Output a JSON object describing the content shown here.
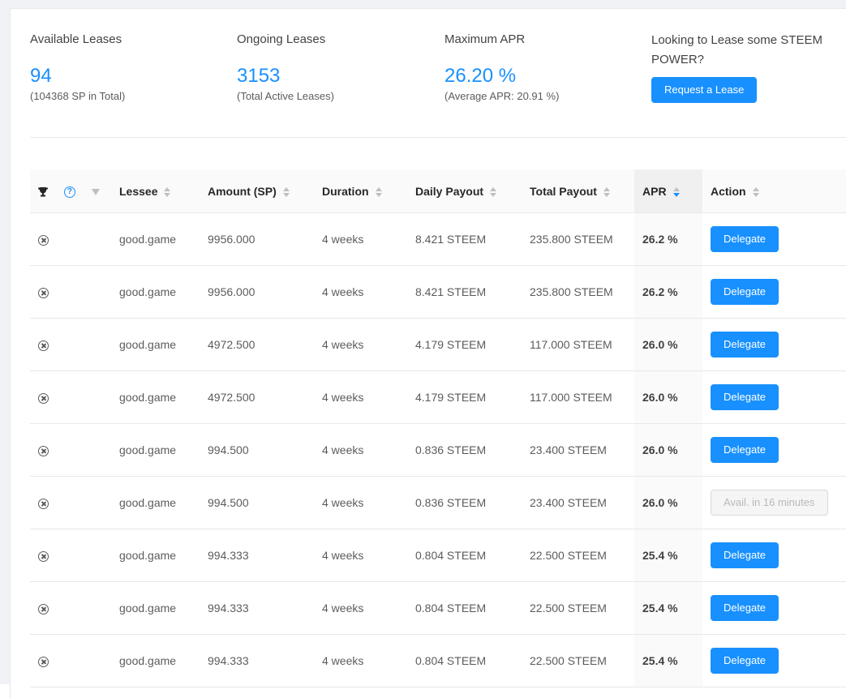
{
  "stats": {
    "available": {
      "label": "Available Leases",
      "value": "94",
      "sub": "(104368 SP in Total)"
    },
    "ongoing": {
      "label": "Ongoing Leases",
      "value": "3153",
      "sub": "(Total Active Leases)"
    },
    "max_apr": {
      "label": "Maximum APR",
      "value": "26.20 %",
      "sub": "(Average APR: 20.91 %)"
    },
    "cta": {
      "label": "Looking to Lease some STEEM POWER?",
      "button": "Request a Lease"
    }
  },
  "table": {
    "headers": {
      "lessee": "Lessee",
      "amount": "Amount (SP)",
      "duration": "Duration",
      "daily": "Daily Payout",
      "total": "Total Payout",
      "apr": "APR",
      "action": "Action"
    },
    "sorted_column": "apr",
    "sort_direction": "descending",
    "rows": [
      {
        "lessee": "good.game",
        "amount": "9956.000",
        "duration": "4 weeks",
        "daily": "8.421 STEEM",
        "total": "235.800 STEEM",
        "apr": "26.2 %",
        "action": "Delegate",
        "enabled": true
      },
      {
        "lessee": "good.game",
        "amount": "9956.000",
        "duration": "4 weeks",
        "daily": "8.421 STEEM",
        "total": "235.800 STEEM",
        "apr": "26.2 %",
        "action": "Delegate",
        "enabled": true
      },
      {
        "lessee": "good.game",
        "amount": "4972.500",
        "duration": "4 weeks",
        "daily": "4.179 STEEM",
        "total": "117.000 STEEM",
        "apr": "26.0 %",
        "action": "Delegate",
        "enabled": true
      },
      {
        "lessee": "good.game",
        "amount": "4972.500",
        "duration": "4 weeks",
        "daily": "4.179 STEEM",
        "total": "117.000 STEEM",
        "apr": "26.0 %",
        "action": "Delegate",
        "enabled": true
      },
      {
        "lessee": "good.game",
        "amount": "994.500",
        "duration": "4 weeks",
        "daily": "0.836 STEEM",
        "total": "23.400 STEEM",
        "apr": "26.0 %",
        "action": "Delegate",
        "enabled": true
      },
      {
        "lessee": "good.game",
        "amount": "994.500",
        "duration": "4 weeks",
        "daily": "0.836 STEEM",
        "total": "23.400 STEEM",
        "apr": "26.0 %",
        "action": "Avail. in 16 minutes",
        "enabled": false
      },
      {
        "lessee": "good.game",
        "amount": "994.333",
        "duration": "4 weeks",
        "daily": "0.804 STEEM",
        "total": "22.500 STEEM",
        "apr": "25.4 %",
        "action": "Delegate",
        "enabled": true
      },
      {
        "lessee": "good.game",
        "amount": "994.333",
        "duration": "4 weeks",
        "daily": "0.804 STEEM",
        "total": "22.500 STEEM",
        "apr": "25.4 %",
        "action": "Delegate",
        "enabled": true
      },
      {
        "lessee": "good.game",
        "amount": "994.333",
        "duration": "4 weeks",
        "daily": "0.804 STEEM",
        "total": "22.500 STEEM",
        "apr": "25.4 %",
        "action": "Delegate",
        "enabled": true
      }
    ]
  },
  "icons": {
    "trophy": "trophy-icon",
    "help": "help-icon",
    "filter": "filter-icon",
    "cancel": "cancel-icon",
    "sort": "sort-icon"
  },
  "colors": {
    "accent": "#1890ff",
    "disabled_bg": "#f5f5f5"
  }
}
